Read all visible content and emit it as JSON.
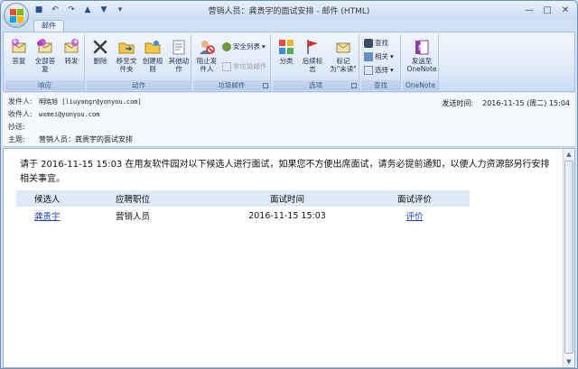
{
  "window": {
    "title": "营销人员：龚贵宇的面试安排 - 邮件 (HTML)",
    "controls": {
      "minimize": "—",
      "maximize": "□",
      "close": "✕"
    }
  },
  "tabs": {
    "active": "邮件"
  },
  "ribbon": {
    "groups": {
      "respond": {
        "label": "响应",
        "buttons": [
          "答复",
          "全部答复",
          "转发"
        ]
      },
      "actions": {
        "label": "动作",
        "buttons": [
          "删除",
          "移至文件夹",
          "创建规则",
          "其他动作"
        ]
      },
      "junk": {
        "label": "垃圾邮件",
        "block": "阻止发件人",
        "safe_list": "安全列表",
        "not_junk": "非垃圾邮件"
      },
      "options": {
        "label": "选项",
        "buttons": [
          "分类",
          "后续标志",
          "标记为\"未读\""
        ]
      },
      "find": {
        "label": "查找",
        "items": [
          "查找",
          "相关",
          "选择"
        ]
      },
      "onenote": {
        "label": "OneNote",
        "button": "发送至OneNote"
      }
    }
  },
  "message": {
    "from_label": "发件人:",
    "from": "明晓旭 [liuyangr@yonyou.com]",
    "to_label": "收件人:",
    "to": "wxmei@yonyou.com",
    "cc_label": "抄送:",
    "cc": "",
    "subject_label": "主题:",
    "subject": "营销人员：龚贵宇的面试安排",
    "sent_label": "发送时间:",
    "sent": "2016-11-15 (周二) 15:04"
  },
  "body": {
    "text": "请于 2016-11-15 15:03 在用友软件园对以下候选人进行面试，如果您不方便出席面试，请务必提前通知，以便人力资源部另行安排相关事宜。",
    "table": {
      "headers": [
        "候选人",
        "应聘职位",
        "面试时间",
        "面试评价"
      ],
      "rows": [
        {
          "candidate": "龚贵宇",
          "position": "营销人员",
          "time": "2016-11-15 15:03",
          "evaluation": "评价"
        }
      ]
    }
  },
  "colors": {
    "link": "#1f3fb8",
    "table_header": "#dde9f6"
  }
}
